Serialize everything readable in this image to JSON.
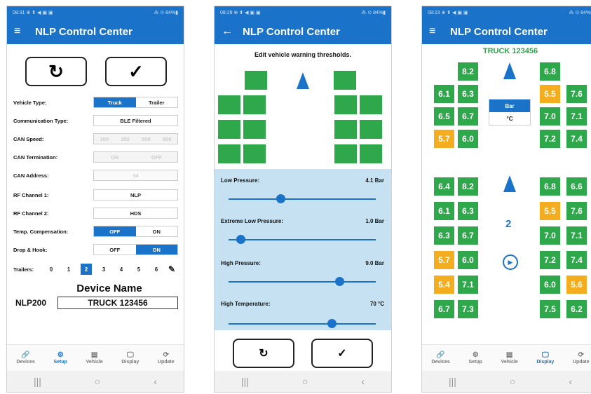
{
  "status_bar": {
    "p1_time": "08:31 ⊕ ⬆ ◀ ▣ ▣",
    "p2_time": "08:28 ⊕ ⬆ ◀ ▣ ▣",
    "p3_time": "08:23 ⊕ ⬆ ◀ ▣ ▣",
    "p1_right": "⁂ ⊙ 84%▮",
    "p2_right": "⁂ ⊙ 84%▮",
    "p3_right": "⁂ ⊙ 84%▮"
  },
  "app": {
    "title": "NLP Control Center",
    "menu_icon": "≡",
    "back_icon": "←"
  },
  "setup": {
    "refresh_glyph": "↻",
    "check_glyph": "✓",
    "vehicle_type": {
      "label": "Vehicle Type:",
      "options": [
        "Truck",
        "Trailer"
      ],
      "selected": "Truck"
    },
    "comm_type": {
      "label": "Communication Type:",
      "value": "BLE Filtered"
    },
    "can_speed": {
      "label": "CAN Speed:",
      "options": [
        "100",
        "250",
        "500",
        "800"
      ]
    },
    "can_term": {
      "label": "CAN Termination:",
      "options": [
        "ON",
        "OFF"
      ]
    },
    "can_address": {
      "label": "CAN Address:",
      "value": "34"
    },
    "rf1": {
      "label": "RF Channel 1:",
      "value": "NLP"
    },
    "rf2": {
      "label": "RF Channel 2:",
      "value": "HDS"
    },
    "temp_comp": {
      "label": "Temp. Compensation:",
      "options": [
        "OFF",
        "ON"
      ],
      "selected": "OFF"
    },
    "drop_hook": {
      "label": "Drop & Hook:",
      "options": [
        "OFF",
        "ON"
      ],
      "selected": "ON"
    },
    "trailers": {
      "label": "Trailers:",
      "options": [
        "0",
        "1",
        "2",
        "3",
        "4",
        "5",
        "6"
      ],
      "selected": "2",
      "edit_glyph": "✎"
    },
    "device_name_heading": "Device Name",
    "device_model": "NLP200",
    "device_name_value": "TRUCK 123456"
  },
  "thresholds": {
    "header": "Edit vehicle warning thresholds.",
    "low_pressure": {
      "label": "Low Pressure:",
      "value": "4.1 Bar",
      "level": 0.35
    },
    "extreme_low": {
      "label": "Extreme Low Pressure:",
      "value": "1.0 Bar",
      "level": 0.08
    },
    "high_pressure": {
      "label": "High Pressure:",
      "value": "9.0 Bar",
      "level": 0.75
    },
    "high_temp": {
      "label": "High Temperature:",
      "value": "70 °C",
      "level": 0.7
    },
    "refresh_glyph": "↻",
    "check_glyph": "✓"
  },
  "display": {
    "truck_name": "TRUCK 123456",
    "unit_bar": "Bar",
    "unit_c": "°C",
    "trailer_number": "2",
    "play_glyph": "▶",
    "truck_tiles": [
      "8.2",
      "6.8",
      "6.1",
      "6.3",
      "5.5",
      "7.6",
      "6.5",
      "6.7",
      "7.0",
      "7.1",
      "5.7",
      "6.0",
      "7.2",
      "7.4"
    ],
    "trailer_tiles": [
      "6.4",
      "8.2",
      "6.8",
      "6.6",
      "6.1",
      "6.3",
      "5.5",
      "7.6",
      "6.3",
      "6.7",
      "7.0",
      "7.1",
      "5.7",
      "6.0",
      "7.2",
      "7.4",
      "5.4",
      "7.1",
      "6.0",
      "5.6",
      "6.7",
      "7.3",
      "7.5",
      "6.2"
    ],
    "colors": {
      "green": "#2ea84a",
      "orange": "#f3ad1e",
      "blue": "#1a72c9"
    }
  },
  "nav": {
    "items": [
      "Devices",
      "Setup",
      "Vehicle",
      "Display",
      "Update"
    ],
    "icons": [
      "🔗",
      "⚙",
      "▤",
      "🖵",
      "⟳"
    ]
  },
  "system_nav": {
    "recents": "|||",
    "home": "○",
    "back": "‹"
  }
}
